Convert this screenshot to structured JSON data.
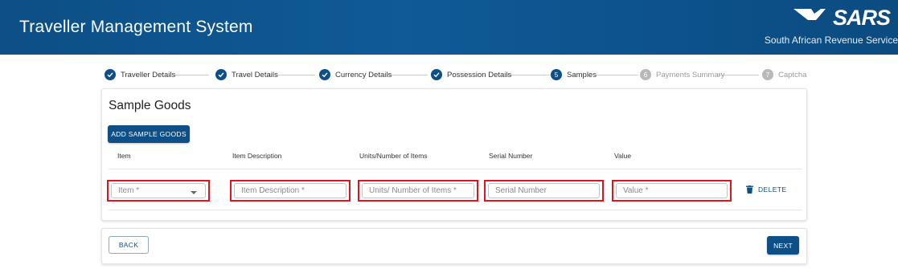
{
  "header": {
    "title": "Traveller Management System",
    "logo_text": "SARS",
    "org_name": "South African Revenue Service"
  },
  "stepper": {
    "steps": [
      {
        "number": "",
        "label": "Traveller Details",
        "status": "complete"
      },
      {
        "number": "",
        "label": "Travel Details",
        "status": "complete"
      },
      {
        "number": "",
        "label": "Currency Details",
        "status": "complete"
      },
      {
        "number": "",
        "label": "Possession Details",
        "status": "complete"
      },
      {
        "number": "5",
        "label": "Samples",
        "status": "active"
      },
      {
        "number": "6",
        "label": "Payments Summary",
        "status": "pending"
      },
      {
        "number": "7",
        "label": "Captcha",
        "status": "pending"
      }
    ]
  },
  "main": {
    "title": "Sample Goods",
    "add_button": "ADD SAMPLE GOODS",
    "columns": [
      "Item",
      "Item Description",
      "Units/Number of Items",
      "Serial Number",
      "Value"
    ],
    "row": {
      "item_placeholder": "Item *",
      "description_placeholder": "Item Description *",
      "units_placeholder": "Units/ Number of Items *",
      "serial_placeholder": "Serial Number",
      "value_placeholder": "Value *",
      "delete_label": "DELETE"
    }
  },
  "footer": {
    "back_label": "BACK",
    "next_label": "NEXT"
  },
  "colors": {
    "brand": "#0d4f86",
    "highlight": "#e0141e"
  }
}
